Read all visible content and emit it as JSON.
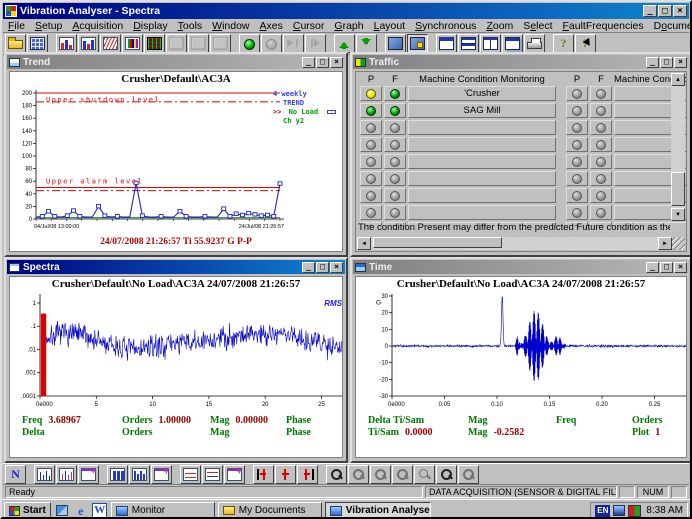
{
  "window": {
    "title": "Vibration Analyser - Spectra"
  },
  "glyphs": {
    "minimize": "_",
    "restore": "□",
    "close": "×",
    "scroll_up": "▲",
    "scroll_down": "▼",
    "scroll_left": "◄",
    "scroll_right": "►",
    "ie": "e",
    "word": "W"
  },
  "colors": {
    "title_active_start": "#000080",
    "title_active_end": "#1084d0",
    "chart_blue": "#2222cc",
    "limit_red": "#ee0000",
    "label_green": "#007800",
    "value_red": "#a00000"
  },
  "menu": {
    "items": [
      {
        "label": "File",
        "u": 0
      },
      {
        "label": "Setup",
        "u": 0
      },
      {
        "label": "Acquisition",
        "u": 0
      },
      {
        "label": "Display",
        "u": 0
      },
      {
        "label": "Tools",
        "u": 0
      },
      {
        "label": "Window",
        "u": 0
      },
      {
        "label": "Axes",
        "u": 0
      },
      {
        "label": "Cursor",
        "u": 0
      },
      {
        "label": "Graph",
        "u": 0
      },
      {
        "label": "Layout",
        "u": 0
      },
      {
        "label": "Synchronous",
        "u": 0
      },
      {
        "label": "Zoom",
        "u": 0
      },
      {
        "label": "Select",
        "u": 1
      },
      {
        "label": "FaultFrequencies",
        "u": 0
      },
      {
        "label": "Documentations",
        "u": 1
      },
      {
        "label": "Help",
        "u": 0
      }
    ]
  },
  "toolbar_top": [
    {
      "name": "open-button",
      "icon": "folder"
    },
    {
      "name": "workspace-button",
      "icon": "bluegrid"
    },
    {
      "sep": true
    },
    {
      "name": "trend-chart-button",
      "icon": "chart-red"
    },
    {
      "name": "spectra-chart-button",
      "icon": "chart-red2"
    },
    {
      "name": "waveform-chart-button",
      "icon": "chart-wave"
    },
    {
      "name": "multi-chart-button",
      "icon": "chart-grid"
    },
    {
      "name": "matrix-chart-button",
      "icon": "chart-dark"
    },
    {
      "name": "layout-a-button",
      "icon": "gray1",
      "disabled": true
    },
    {
      "name": "layout-b-button",
      "icon": "gray2",
      "disabled": true
    },
    {
      "name": "layout-c-button",
      "icon": "gray3",
      "disabled": true
    },
    {
      "sep": true
    },
    {
      "name": "acquire-start-button",
      "icon": "dot-green"
    },
    {
      "name": "acquire-stop-button",
      "icon": "dot-gray",
      "disabled": true
    },
    {
      "name": "step-forward-button",
      "icon": "arrow-end",
      "disabled": true
    },
    {
      "name": "step-last-button",
      "icon": "arrow-bar",
      "disabled": true
    },
    {
      "sep": true
    },
    {
      "name": "nav-up-button",
      "icon": "up-green"
    },
    {
      "name": "nav-down-button",
      "icon": "down-green"
    },
    {
      "sep": true
    },
    {
      "name": "monitor-a-button",
      "icon": "monitor"
    },
    {
      "name": "monitor-b-button",
      "icon": "monitor2",
      "pressed": true
    },
    {
      "sep": true
    },
    {
      "name": "window-new-button",
      "icon": "win-single"
    },
    {
      "name": "tile-horizontal-button",
      "icon": "tile-h"
    },
    {
      "name": "tile-vertical-button",
      "icon": "tile-v"
    },
    {
      "name": "cascade-button",
      "icon": "win-frame"
    },
    {
      "name": "print-button",
      "icon": "printer"
    },
    {
      "sep": true
    },
    {
      "name": "help-button",
      "icon": "help"
    },
    {
      "name": "context-help-button",
      "icon": "help-arrow"
    }
  ],
  "toolbar_bottom": [
    {
      "name": "normal-cursor-button",
      "icon": "N"
    },
    {
      "sep": true
    },
    {
      "name": "single-spectrum-button",
      "icon": "peaks-blue"
    },
    {
      "name": "waterfall-button",
      "icon": "peaks-pink"
    },
    {
      "name": "spectrum-window-button",
      "icon": "win-plus"
    },
    {
      "sep": true
    },
    {
      "name": "bar-graph-button",
      "icon": "bars-blue"
    },
    {
      "name": "bar-graph2-button",
      "icon": "bars-blue2"
    },
    {
      "name": "bars-window-button",
      "icon": "win-plus"
    },
    {
      "sep": true
    },
    {
      "name": "overlay-button",
      "icon": "red-wave"
    },
    {
      "name": "overlay2-button",
      "icon": "red-wave2"
    },
    {
      "name": "overlay-window-button",
      "icon": "win-plus"
    },
    {
      "sep": true
    },
    {
      "name": "cursor-left-button",
      "icon": "cursor-left"
    },
    {
      "name": "cursor-center-button",
      "icon": "cursor-mid"
    },
    {
      "name": "cursor-right-button",
      "icon": "cursor-right"
    },
    {
      "sep": true
    },
    {
      "name": "zoom-in-button",
      "icon": "mag-plus"
    },
    {
      "name": "zoom-prev-button",
      "icon": "mag",
      "disabled": true
    },
    {
      "name": "zoom-next-button",
      "icon": "mag",
      "disabled": true
    },
    {
      "name": "zoom-out-button",
      "icon": "mag",
      "disabled": true
    },
    {
      "name": "zoom-reset-button",
      "icon": "mag2",
      "disabled": true
    },
    {
      "name": "zoom-box-button",
      "icon": "mag-plus"
    },
    {
      "name": "zoom-undo-button",
      "icon": "mag",
      "disabled": true
    }
  ],
  "windows": {
    "trend": {
      "title": "Trend"
    },
    "traffic": {
      "title": "Traffic",
      "header": {
        "p": "P",
        "f": "F",
        "label": "Machine Condition Monitoring"
      },
      "left_rows": [
        [
          "yellow",
          "green",
          "'Crusher"
        ],
        [
          "green",
          "green",
          "SAG Mill"
        ],
        [
          "gray",
          "gray",
          ""
        ],
        [
          "gray",
          "gray",
          ""
        ],
        [
          "gray",
          "gray",
          ""
        ],
        [
          "gray",
          "gray",
          ""
        ],
        [
          "gray",
          "gray",
          ""
        ],
        [
          "gray",
          "gray",
          ""
        ],
        [
          "gray",
          "gray",
          ""
        ],
        [
          "gray",
          "gray",
          ""
        ]
      ],
      "right_rows": [
        [
          "gray",
          "gray",
          ""
        ],
        [
          "gray",
          "gray",
          ""
        ],
        [
          "gray",
          "gray",
          ""
        ],
        [
          "gray",
          "gray",
          ""
        ],
        [
          "gray",
          "gray",
          ""
        ],
        [
          "gray",
          "gray",
          ""
        ],
        [
          "gray",
          "gray",
          ""
        ],
        [
          "gray",
          "gray",
          ""
        ],
        [
          "gray",
          "gray",
          ""
        ],
        [
          "gray",
          "gray",
          ""
        ]
      ],
      "note": "The condition Present may differ from the predicted Future condition as the Future condition is updat"
    },
    "spectra": {
      "title": "Spectra"
    },
    "time": {
      "title": "Time"
    }
  },
  "chart_data": [
    {
      "id": "trend",
      "type": "line",
      "title": "Crusher\\Default\\AC3A",
      "ylim": [
        0,
        200
      ],
      "ytick_step": 20,
      "x_labels": [
        "04/Jul/08 13:00:00",
        "24/Jul/08 21:26:57"
      ],
      "limits": {
        "upper_shutdown": {
          "label": "Upper shutdown level",
          "solid": 200,
          "dashdot": 186
        },
        "upper_alarm": {
          "label": "Upper alarm level",
          "solid": 50,
          "dashdot": 45
        }
      },
      "series": [
        {
          "name": "4 weekly TREND",
          "color": "#2222cc",
          "marker": "square",
          "values": [
            3,
            4,
            12,
            4,
            3,
            5,
            13,
            4,
            3,
            3,
            20,
            5,
            3,
            4,
            3,
            3,
            57,
            5,
            3,
            3,
            4,
            3,
            3,
            12,
            4,
            3,
            3,
            4,
            3,
            3,
            16,
            4,
            8,
            6,
            9,
            7,
            5,
            6,
            4,
            55.9
          ]
        },
        {
          "name": "No Load",
          "color": "#008000",
          "values": [
            2,
            2,
            2,
            2,
            2,
            2,
            2,
            2,
            2,
            2,
            2,
            2,
            2,
            2,
            2,
            2,
            2,
            2,
            2,
            2,
            2,
            2,
            2,
            2,
            2,
            2,
            2,
            2,
            2,
            2,
            2,
            2,
            2,
            2,
            2,
            2,
            2,
            2,
            2,
            2
          ]
        }
      ],
      "legend": {
        "series1_line1": "4 weekly",
        "series1_line2": "TREND",
        "cursor": ">>",
        "series2_line1": "No Load",
        "series2_line2": "Ch y2"
      },
      "footer": "24/07/2008 21:26:57  Ti 55.9237 G P-P"
    },
    {
      "id": "spectra",
      "type": "line",
      "yscale": "log",
      "title": "Crusher\\Default\\No Load\\AC3A 24/07/2008 21:26:57",
      "ylim": [
        0.0001,
        2
      ],
      "yticks": [
        1,
        0.1,
        0.01,
        0.001,
        0.0001
      ],
      "ytick_labels": [
        "1",
        ".1",
        ".01",
        ".001",
        ".0001"
      ],
      "xlim": [
        0,
        27
      ],
      "xticks": [
        0,
        5,
        10,
        15,
        20,
        25
      ],
      "xtick_labels": [
        "0e000",
        "5",
        "10",
        "15",
        "20",
        "25"
      ],
      "annotation": "RMS",
      "red_band": {
        "x0": 0.08,
        "x1": 0.55,
        "top": 0.35
      },
      "noise": {
        "points": 620,
        "seed": 7,
        "log_sigma": 0.5,
        "envelope": [
          [
            0.6,
            0.03
          ],
          [
            2,
            0.05
          ],
          [
            4,
            0.04
          ],
          [
            6,
            0.015
          ],
          [
            8,
            0.01
          ],
          [
            10,
            0.012
          ],
          [
            12,
            0.02
          ],
          [
            14,
            0.018
          ],
          [
            16,
            0.03
          ],
          [
            18,
            0.045
          ],
          [
            20,
            0.05
          ],
          [
            22,
            0.045
          ],
          [
            24,
            0.025
          ],
          [
            26,
            0.015
          ],
          [
            27,
            0.012
          ]
        ]
      },
      "readout": {
        "row1": [
          {
            "l": "Freq",
            "v": "3.68967"
          },
          {
            "l": "Orders",
            "v": "1.00000"
          },
          {
            "l": "Mag",
            "v": "0.00000"
          },
          {
            "l": "Phase",
            "v": ""
          }
        ],
        "row2": [
          {
            "l": "Delta",
            "v": ""
          },
          {
            "l": "Orders",
            "v": ""
          },
          {
            "l": "Mag",
            "v": ""
          },
          {
            "l": "Phase",
            "v": ""
          }
        ]
      }
    },
    {
      "id": "time",
      "type": "line",
      "title": "Crusher\\Default\\No Load\\AC3A 24/07/2008 21:26:57",
      "ylim": [
        -30,
        30
      ],
      "yticks": [
        30,
        20,
        10,
        0,
        -10,
        -20,
        -30
      ],
      "y_unit": "G",
      "xlim": [
        0,
        0.28
      ],
      "xticks": [
        0,
        0.05,
        0.1,
        0.15,
        0.2,
        0.25
      ],
      "xtick_labels": [
        "0e000",
        "0.05",
        "0.10",
        "0.15",
        "0.20",
        "0.25"
      ],
      "signal": {
        "points": 1000,
        "seed": 3,
        "noise_amp": 0.6,
        "bursts": [
          {
            "t": 0.105,
            "amp": 30,
            "width": 0.001
          },
          {
            "t": 0.12,
            "amp": -8,
            "width": 0.002
          },
          {
            "t": 0.137,
            "amp": 22,
            "width": 0.009
          },
          {
            "t": 0.158,
            "amp": 6,
            "width": 0.005
          }
        ]
      },
      "readout": {
        "row1": [
          {
            "l": "Delta Ti/Sam",
            "v": ""
          },
          {
            "l": "Mag",
            "v": ""
          },
          {
            "l": "Freq",
            "v": ""
          },
          {
            "l": "Orders",
            "v": ""
          }
        ],
        "row2": [
          {
            "l": "Ti/Sam",
            "v": "0.0000"
          },
          {
            "l": "Mag",
            "v": "-0.2582"
          },
          {
            "l": "",
            "v": ""
          },
          {
            "l": "Plot",
            "v": "1"
          }
        ]
      }
    }
  ],
  "statusbar": {
    "ready": "Ready",
    "message": "DATA ACQUISITION (SENSOR & DIGITAL FILTER SE",
    "num": "NUM"
  },
  "taskbar": {
    "start_label": "Start",
    "tasks": [
      "Monitor",
      "My Documents",
      "Vibration Analyser - ..."
    ],
    "lang": "EN",
    "time": "8:38 AM"
  }
}
